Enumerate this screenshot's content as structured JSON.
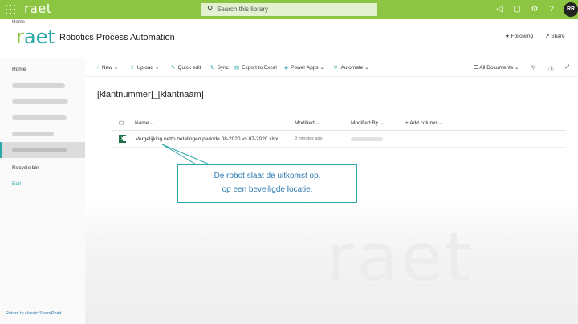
{
  "topbar": {
    "logo": "raet",
    "search_placeholder": "Search this library",
    "avatar_initials": "RR",
    "brand_color": "#8bc541",
    "icons": [
      "waffle-icon",
      "megaphone-icon",
      "notification-icon",
      "settings-icon",
      "help-icon"
    ]
  },
  "site": {
    "breadcrumb": "Home",
    "logo_text": "raet",
    "title": "Robotics Process Automation",
    "following_label": "Following",
    "share_label": "Share",
    "accent_color": "#2aa7a8"
  },
  "leftnav": {
    "home": "Home",
    "recycle_bin": "Recycle bin",
    "edit": "Edit",
    "return_classic": "Return to classic SharePoint"
  },
  "commandbar": {
    "new": "New",
    "upload": "Upload",
    "quick_edit": "Quick edit",
    "sync": "Sync",
    "export": "Export to Excel",
    "power_apps": "Power Apps",
    "automate": "Automate",
    "more": "···",
    "view": "All Documents"
  },
  "library": {
    "title": "[klantnummer]_[klantnaam]",
    "columns": {
      "name": "Name",
      "modified": "Modified",
      "modified_by": "Modified By",
      "add_column": "+ Add column"
    },
    "files": [
      {
        "name": "Vergelijking netto betalingen periode 08-2020 vs 07-2020.xlsx",
        "modified": "9 minutes ago",
        "icon": "excel-file-icon"
      }
    ]
  },
  "callout": {
    "line1": "De robot slaat de uitkomst op,",
    "line2": "op een beveiligde locatie."
  },
  "watermark": "raet"
}
